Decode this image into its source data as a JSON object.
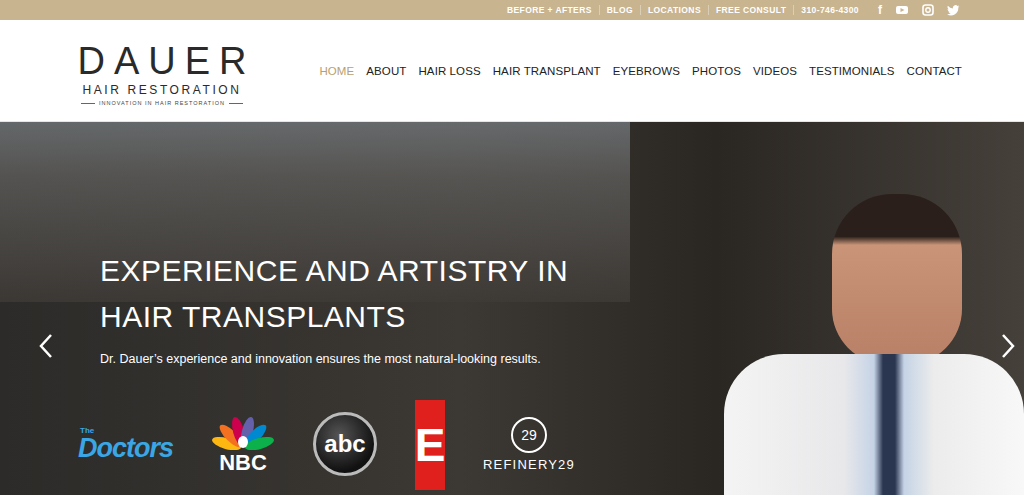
{
  "top_bar": {
    "links": [
      {
        "label": "BEFORE + AFTERS"
      },
      {
        "label": "BLOG"
      },
      {
        "label": "LOCATIONS"
      },
      {
        "label": "FREE CONSULT"
      },
      {
        "label": "310-746-4300"
      }
    ],
    "social": [
      {
        "kind": "facebook",
        "glyph": "f"
      },
      {
        "kind": "youtube",
        "glyph": ""
      },
      {
        "kind": "instagram",
        "glyph": ""
      },
      {
        "kind": "twitter",
        "glyph": ""
      }
    ]
  },
  "logo": {
    "name": "DAUER",
    "subtitle": "HAIR RESTORATION",
    "tagline": "INNOVATION IN HAIR RESTORATION"
  },
  "nav": [
    {
      "label": "HOME",
      "selected": true
    },
    {
      "label": "ABOUT",
      "selected": false
    },
    {
      "label": "HAIR LOSS",
      "selected": false
    },
    {
      "label": "HAIR TRANSPLANT",
      "selected": false
    },
    {
      "label": "EYEBROWS",
      "selected": false
    },
    {
      "label": "PHOTOS",
      "selected": false
    },
    {
      "label": "VIDEOS",
      "selected": false
    },
    {
      "label": "TESTIMONIALS",
      "selected": false
    },
    {
      "label": "CONTACT",
      "selected": false
    }
  ],
  "hero": {
    "title_lines": [
      "EXPERIENCE AND ARTISTRY IN",
      "HAIR TRANSPLANTS"
    ],
    "subtitle": "Dr. Dauer’s experience and innovation ensures the most natural-looking results.",
    "media": [
      {
        "kind": "doctors",
        "small": "The",
        "label": "Doctors"
      },
      {
        "kind": "nbc",
        "small": "",
        "label": "NBC"
      },
      {
        "kind": "abc",
        "small": "",
        "label": "abc"
      },
      {
        "kind": "e",
        "small": "",
        "label": "E"
      },
      {
        "kind": "refinery29",
        "small": "29",
        "label": "REFINERY29"
      }
    ]
  }
}
